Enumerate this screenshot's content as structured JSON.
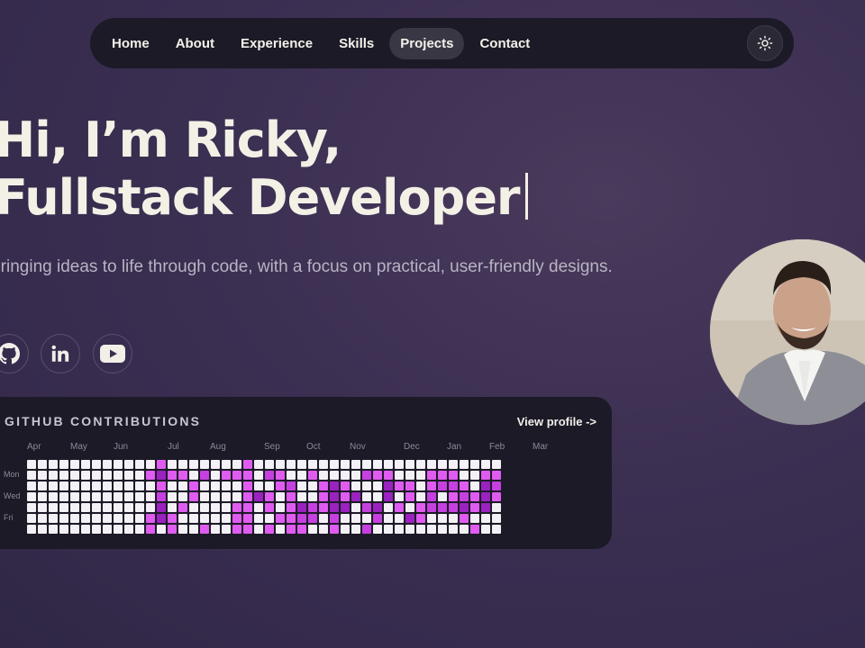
{
  "nav": {
    "items": [
      {
        "label": "Home",
        "active": false
      },
      {
        "label": "About",
        "active": false
      },
      {
        "label": "Experience",
        "active": false
      },
      {
        "label": "Skills",
        "active": false
      },
      {
        "label": "Projects",
        "active": true
      },
      {
        "label": "Contact",
        "active": false
      }
    ],
    "theme_icon": "sun-icon"
  },
  "hero": {
    "line1": "Hi, I’m Ricky,",
    "line2": "Fullstack Developer",
    "subtitle": "Bringing ideas to life through code, with a focus on practical, user-friendly designs."
  },
  "social": [
    {
      "icon": "github-icon"
    },
    {
      "icon": "linkedin-icon"
    },
    {
      "icon": "youtube-icon"
    }
  ],
  "github": {
    "title": "GITHUB CONTRIBUTIONS",
    "view_profile": "View profile ->",
    "months": [
      "Apr",
      "May",
      "Jun",
      "Jul",
      "Aug",
      "Sep",
      "Oct",
      "Nov",
      "Dec",
      "Jan",
      "Feb",
      "Mar"
    ],
    "days": [
      "Mon",
      "Wed",
      "Fri"
    ],
    "colors": {
      "empty": "#f3f1f5",
      "l1": "#e05cf0",
      "l2": "#c640e0",
      "l3": "#9b22c0"
    },
    "levels": [
      "00000000000010000000100000000000000000000000",
      "00000000000131102011102100100002110001110011",
      "00000000000010010000100120013100031101221032",
      "00000000000020010000131010013130030102012131",
      "00000000000030100001101013213302301012223130",
      "00000000000131000001100112202000200310001000",
      "00000000000101001001101011001002000000000100"
    ]
  }
}
